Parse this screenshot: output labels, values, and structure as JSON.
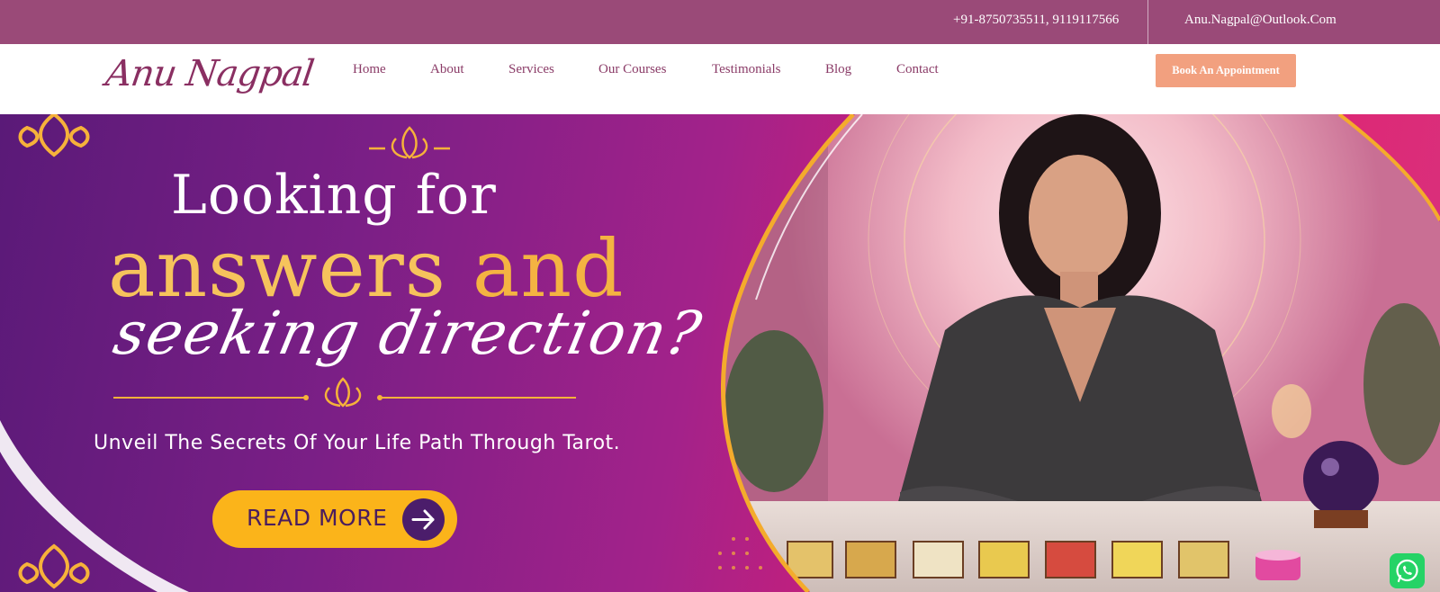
{
  "topbar": {
    "phone": "+91-8750735511, 9119117566",
    "email": "Anu.Nagpal@Outlook.Com",
    "bg_color": "#9a4a78"
  },
  "header": {
    "logo": "Anu Nagpal",
    "nav": [
      "Home",
      "About",
      "Services",
      "Our Courses",
      "Testimonials",
      "Blog",
      "Contact"
    ],
    "cta": "Book An Appointment",
    "accent_color": "#f2a07f"
  },
  "hero": {
    "headline_line1": "Looking for",
    "headline_word_answers": "answers",
    "headline_word_and": "and",
    "headline_line3": "seeking direction?",
    "subtitle": "Unveil The Secrets Of Your Life Path Through Tarot.",
    "cta": "READ MORE",
    "cta_color": "#fbb41a"
  },
  "icons": [
    "lotus-icon",
    "ornament-icon",
    "arrow-right-icon",
    "whatsapp-icon"
  ]
}
